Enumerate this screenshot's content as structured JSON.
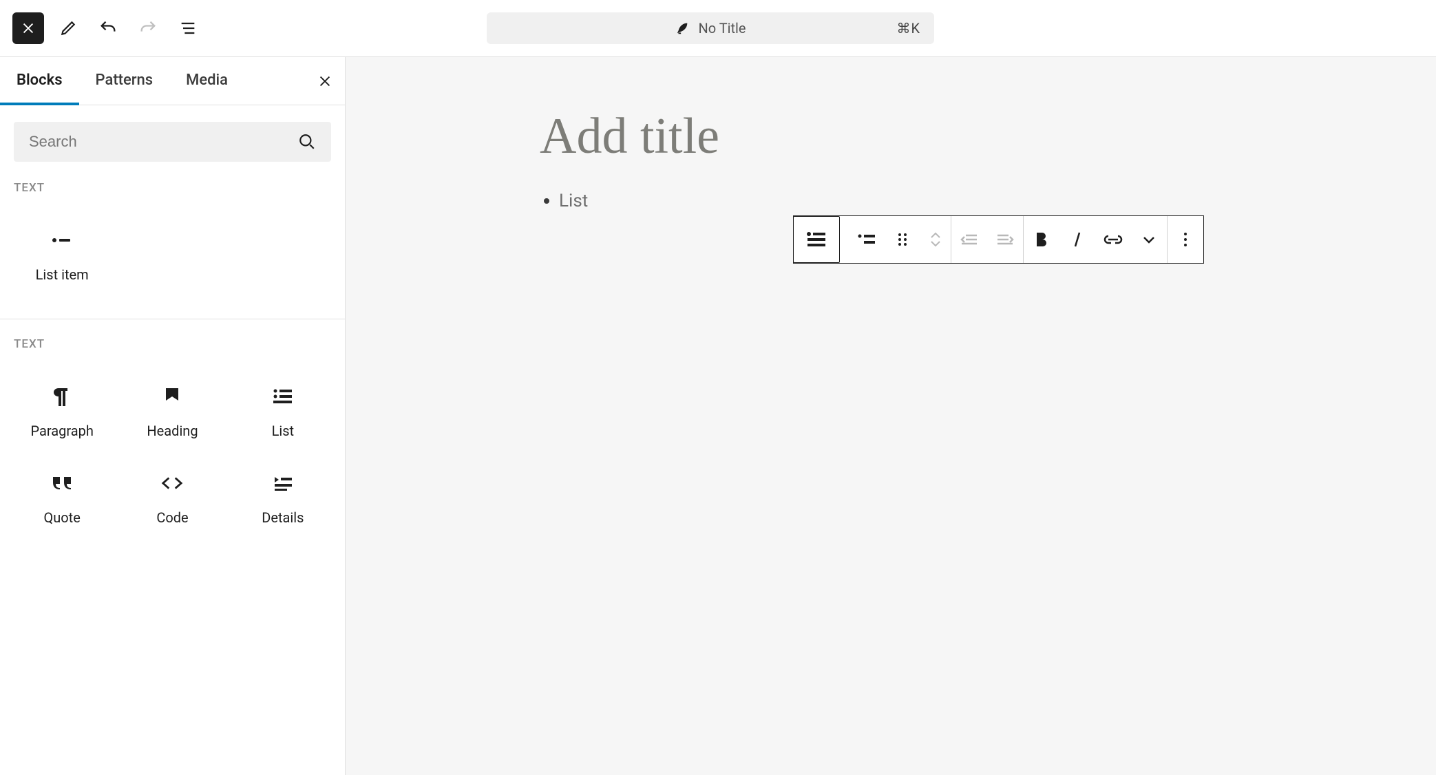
{
  "topbar": {
    "title": "No Title",
    "shortcut": "⌘K"
  },
  "sidebar": {
    "tabs": {
      "blocks": "Blocks",
      "patterns": "Patterns",
      "media": "Media"
    },
    "search_placeholder": "Search",
    "sections": [
      {
        "label": "TEXT",
        "items": [
          {
            "icon": "list-item",
            "label": "List item"
          }
        ]
      },
      {
        "label": "TEXT",
        "items": [
          {
            "icon": "paragraph",
            "label": "Paragraph"
          },
          {
            "icon": "heading",
            "label": "Heading"
          },
          {
            "icon": "list",
            "label": "List"
          },
          {
            "icon": "quote",
            "label": "Quote"
          },
          {
            "icon": "code",
            "label": "Code"
          },
          {
            "icon": "details",
            "label": "Details"
          }
        ]
      }
    ]
  },
  "canvas": {
    "title_placeholder": "Add title",
    "list_placeholder": "List"
  }
}
